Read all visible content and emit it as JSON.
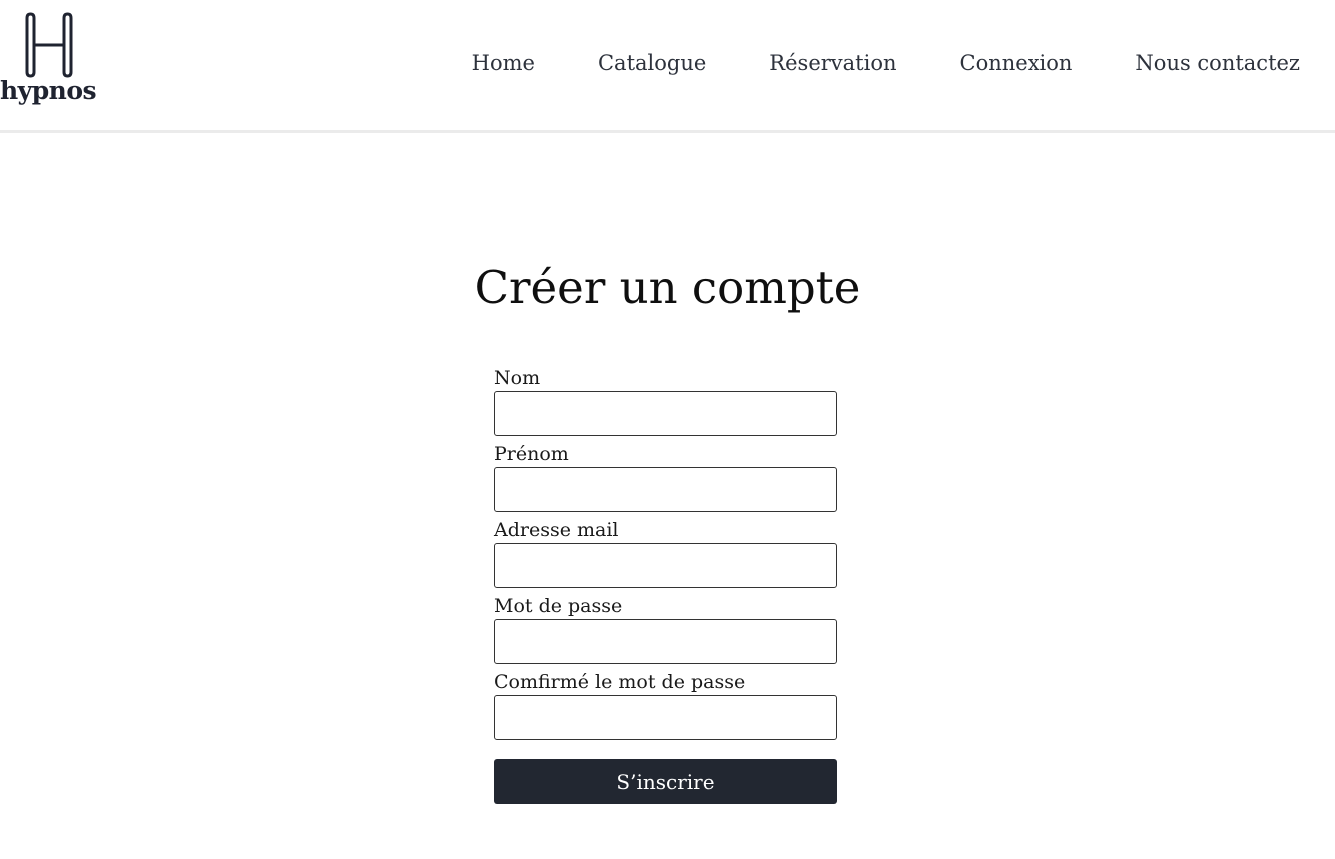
{
  "brand": {
    "logo_text": "hypnos",
    "logo_icon": "h-monogram-icon"
  },
  "nav": {
    "items": [
      {
        "label": "Home"
      },
      {
        "label": "Catalogue"
      },
      {
        "label": "Réservation"
      },
      {
        "label": "Connexion"
      },
      {
        "label": "Nous contactez"
      }
    ]
  },
  "page": {
    "title": "Créer un compte"
  },
  "form": {
    "fields": [
      {
        "label": "Nom",
        "value": ""
      },
      {
        "label": "Prénom",
        "value": ""
      },
      {
        "label": "Adresse mail",
        "value": ""
      },
      {
        "label": "Mot de passe",
        "value": ""
      },
      {
        "label": "Comfirmé le mot de passe",
        "value": ""
      }
    ],
    "submit_label": "S’inscrire"
  },
  "colors": {
    "button_bg": "#222731",
    "button_text": "#ffffff",
    "nav_text": "#2d323c",
    "header_border": "#ebebeb"
  }
}
